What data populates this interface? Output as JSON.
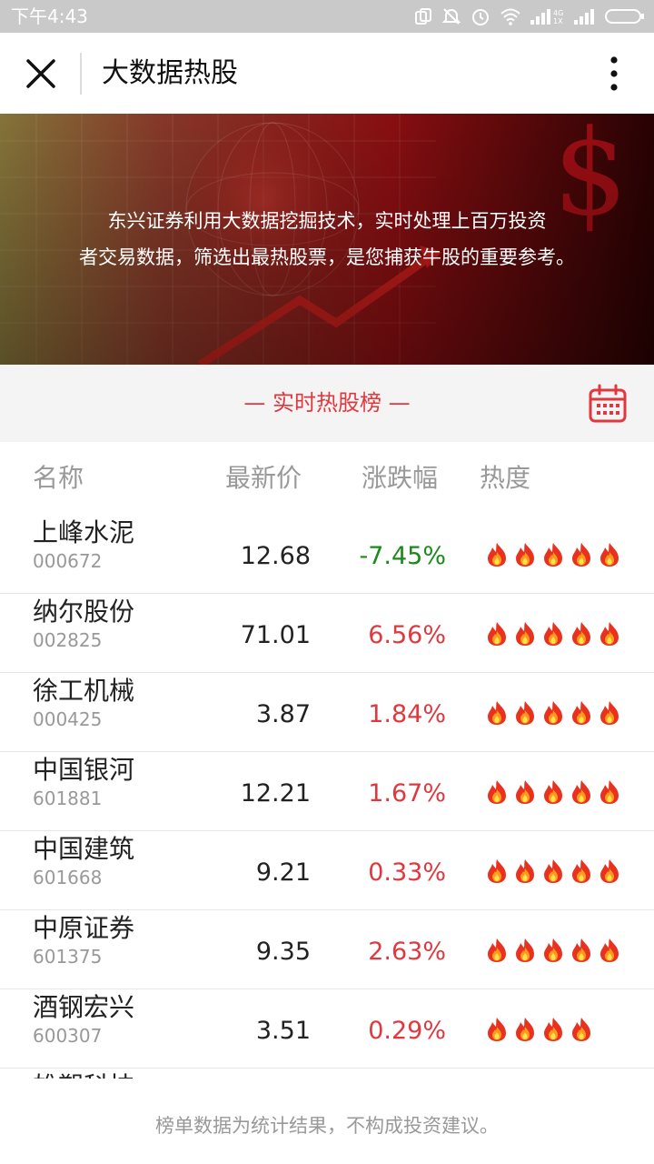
{
  "status_bar": {
    "time": "下午4:43",
    "icons": [
      "copy-icon",
      "mute-icon",
      "alarm-icon",
      "wifi-icon",
      "4g-signal-icon",
      "signal-icon",
      "battery-icon"
    ]
  },
  "nav": {
    "title": "大数据热股",
    "close_icon": "close-icon",
    "more_icon": "more-vertical-icon"
  },
  "banner": {
    "lines": [
      "东兴证券利用大数据挖掘技术，实时处理上百万投资",
      "者交易数据，筛选出最热股票，是您捕获牛股的重要参考。"
    ]
  },
  "section": {
    "title": "— 实时热股榜 —",
    "calendar_icon": "calendar-icon"
  },
  "table": {
    "headers": {
      "name": "名称",
      "price": "最新价",
      "change": "涨跌幅",
      "heat": "热度"
    },
    "rows": [
      {
        "name": "上峰水泥",
        "code": "000672",
        "price": "12.68",
        "change": "-7.45%",
        "direction": "down",
        "heat": 5
      },
      {
        "name": "纳尔股份",
        "code": "002825",
        "price": "71.01",
        "change": "6.56%",
        "direction": "up",
        "heat": 5
      },
      {
        "name": "徐工机械",
        "code": "000425",
        "price": "3.87",
        "change": "1.84%",
        "direction": "up",
        "heat": 5
      },
      {
        "name": "中国银河",
        "code": "601881",
        "price": "12.21",
        "change": "1.67%",
        "direction": "up",
        "heat": 5
      },
      {
        "name": "中国建筑",
        "code": "601668",
        "price": "9.21",
        "change": "0.33%",
        "direction": "up",
        "heat": 5
      },
      {
        "name": "中原证券",
        "code": "601375",
        "price": "9.35",
        "change": "2.63%",
        "direction": "up",
        "heat": 5
      },
      {
        "name": "酒钢宏兴",
        "code": "600307",
        "price": "3.51",
        "change": "0.29%",
        "direction": "up",
        "heat": 4
      },
      {
        "name": "雄塑科技",
        "code": "",
        "price": "",
        "change": "",
        "direction": "up",
        "heat": 0
      }
    ]
  },
  "footer": {
    "disclaimer": "榜单数据为统计结果，不构成投资建议。"
  },
  "colors": {
    "accent": "#e0383e",
    "up": "#e0383e",
    "down": "#1a8a1a"
  }
}
